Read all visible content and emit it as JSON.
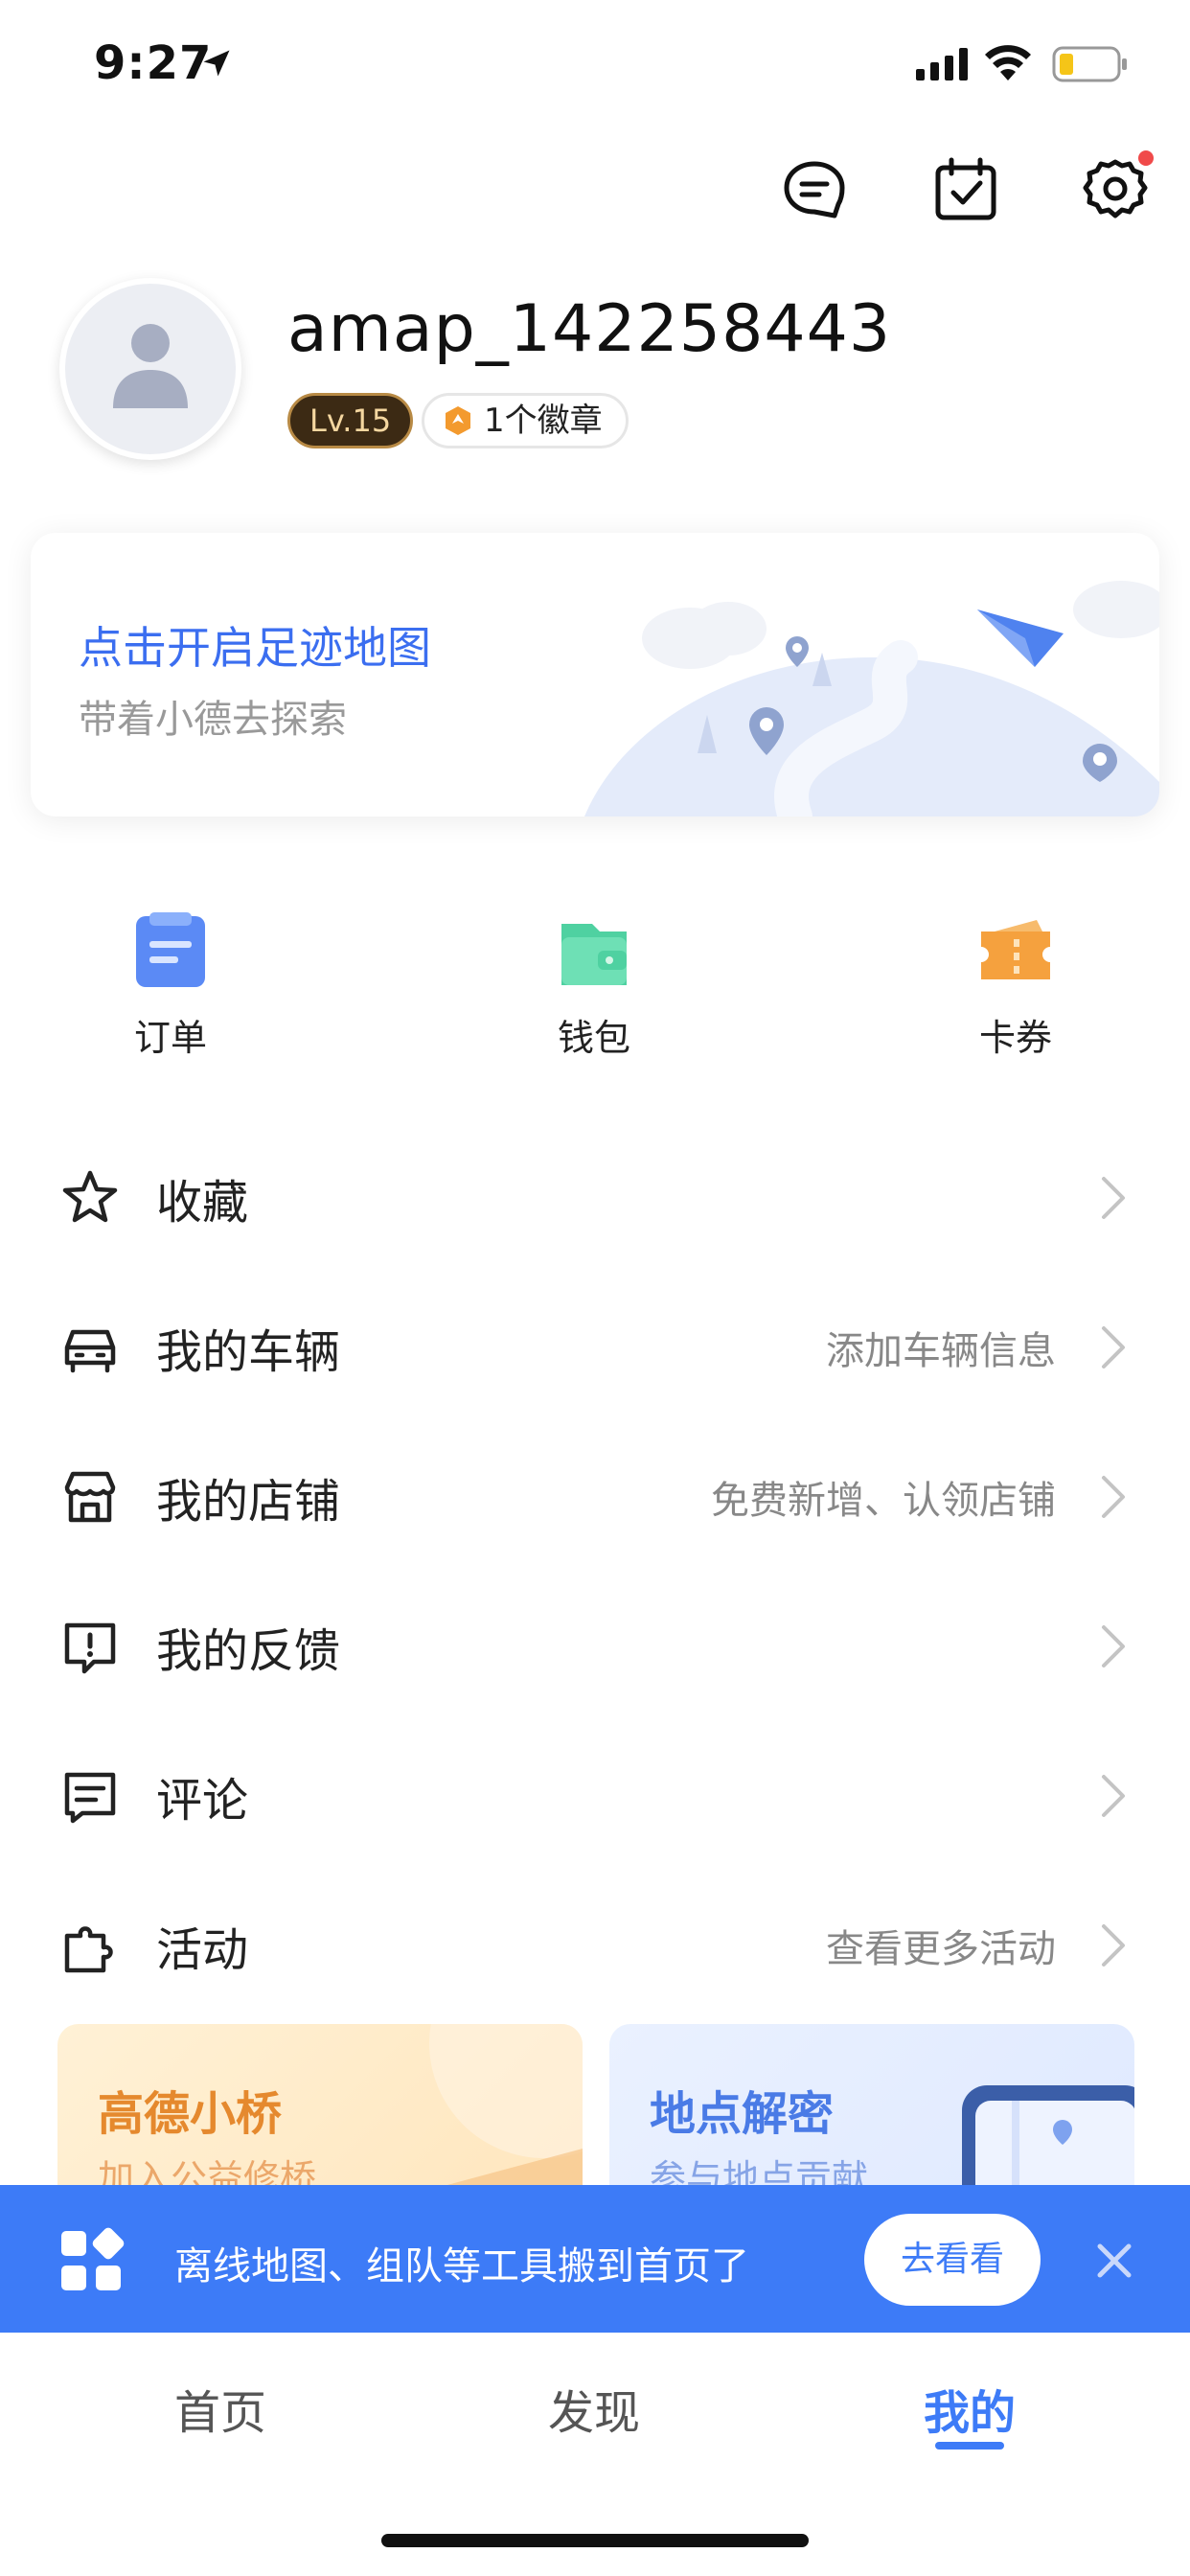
{
  "status_bar": {
    "time": "9:27"
  },
  "profile": {
    "username": "amap_142258443",
    "level": "Lv.15",
    "medal_text": "1个徽章"
  },
  "banner": {
    "title": "点击开启足迹地图",
    "subtitle": "带着小德去探索"
  },
  "quick_entries": [
    {
      "label": "订单",
      "icon": "order-icon",
      "color": "#5b8af5"
    },
    {
      "label": "钱包",
      "icon": "wallet-icon",
      "color": "#4fd1a1"
    },
    {
      "label": "卡券",
      "icon": "coupon-icon",
      "color": "#f5a13e"
    }
  ],
  "menu": [
    {
      "label": "收藏",
      "hint": "",
      "icon": "star-icon"
    },
    {
      "label": "我的车辆",
      "hint": "添加车辆信息",
      "icon": "car-icon"
    },
    {
      "label": "我的店铺",
      "hint": "免费新增、认领店铺",
      "icon": "store-icon"
    },
    {
      "label": "我的反馈",
      "hint": "",
      "icon": "feedback-icon"
    },
    {
      "label": "评论",
      "hint": "",
      "icon": "comment-icon"
    },
    {
      "label": "活动",
      "hint": "查看更多活动",
      "icon": "puzzle-icon"
    }
  ],
  "promo_cards": [
    {
      "title": "高德小桥",
      "subtitle": "加入公益修桥"
    },
    {
      "title": "地点解密",
      "subtitle": "参与地点贡献"
    }
  ],
  "notice": {
    "text": "离线地图、组队等工具搬到首页了",
    "button": "去看看"
  },
  "tabs": [
    {
      "label": "首页"
    },
    {
      "label": "发现"
    },
    {
      "label": "我的",
      "active": true
    }
  ],
  "colors": {
    "accent": "#3d7bf7",
    "notice_bg": "#3d7bf7",
    "badge_red": "#f04a4a"
  }
}
